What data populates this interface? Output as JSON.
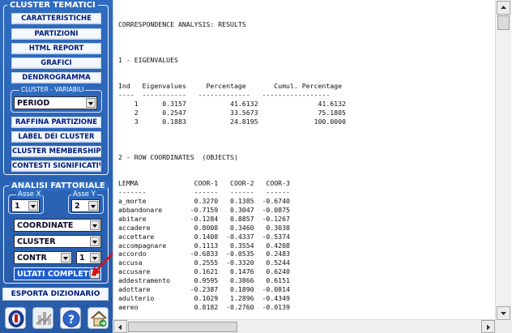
{
  "left_panel": {
    "cluster_tematici": {
      "title": "CLUSTER TEMATICI",
      "buttons": [
        "CARATTERISTICHE",
        "PARTIZIONI",
        "HTML REPORT",
        "GRAFICI",
        "DENDROGRAMMA"
      ],
      "sub_title": "CLUSTER - VARIABILI",
      "variable_value": "PERIOD",
      "buttons2": [
        "RAFFINA PARTIZIONE",
        "LABEL DEI CLUSTER",
        "CLUSTER MEMBERSHIP",
        "CONTESTI SIGNIFICATIVI"
      ]
    },
    "analisi_fattoriale": {
      "title": "ANALISI FATTORIALE",
      "asse_x_label": "Asse X",
      "asse_x_value": "1",
      "asse_y_label": "Asse Y",
      "asse_y_value": "2",
      "combo1": "COORDINATE",
      "combo2": "CLUSTER",
      "combo3": "CONTR",
      "combo3b": "1",
      "combo4": "ULTATI COMPLETI"
    },
    "export_button": "ESPORTA DIZIONARIO",
    "toolbar_icons": [
      "info-icon",
      "chart-icon",
      "help-icon",
      "home-icon"
    ]
  },
  "results": {
    "heading": "CORRESPONDENCE ANALYSIS: RESULTS",
    "eigen_heading": "1 - EIGENVALUES",
    "eigen_columns": [
      "Ind",
      "Eigenvalues",
      "Percentage",
      "Cumul. Percentage"
    ],
    "eigen_rule": "----  -----------   -------------   -----------------",
    "eigen_rows": [
      [
        "1",
        "0.3157",
        "41.6132",
        "41.6132"
      ],
      [
        "2",
        "0.2547",
        "33.5673",
        "75.1805"
      ],
      [
        "3",
        "0.1883",
        "24.8195",
        "100.0000"
      ]
    ],
    "row_heading": "2 - ROW COORDINATES  (OBJECTS)",
    "row_columns": [
      "LEMMA",
      "COOR-1",
      "COOR-2",
      "COOR-3"
    ],
    "row_rule": "-------            ------   ------   ------",
    "row_data": [
      [
        "a_morte",
        "0.3270",
        "0.1385",
        "-0.6740"
      ],
      [
        "abbandonare",
        "-0.7159",
        "0.3047",
        "-0.0875"
      ],
      [
        "abitare",
        "-0.1284",
        "0.8857",
        "-0.1267"
      ],
      [
        "accadere",
        "0.8008",
        "0.3460",
        "0.3038"
      ],
      [
        "accettare",
        "0.1408",
        "-0.4337",
        "-0.5374"
      ],
      [
        "accompagnare",
        "0.1113",
        "0.3554",
        "0.4208"
      ],
      [
        "accordo",
        "-0.6833",
        "-0.0535",
        "0.2483"
      ],
      [
        "accusa",
        "0.2555",
        "-0.3320",
        "0.5244"
      ],
      [
        "accusare",
        "0.1621",
        "0.1476",
        "0.6240"
      ],
      [
        "addestramento",
        "0.9595",
        "0.3866",
        "0.6151"
      ],
      [
        "adottare",
        "-0.2387",
        "0.1890",
        "-0.0814"
      ],
      [
        "adulterio",
        "0.1029",
        "1.2896",
        "-0.4349"
      ],
      [
        "aereo",
        "0.8182",
        "-0.2760",
        "-0.0139"
      ]
    ]
  },
  "colors": {
    "panel_blue": "#2f6cc0",
    "button_text": "#001a7a",
    "arrow_red": "#e01010"
  }
}
